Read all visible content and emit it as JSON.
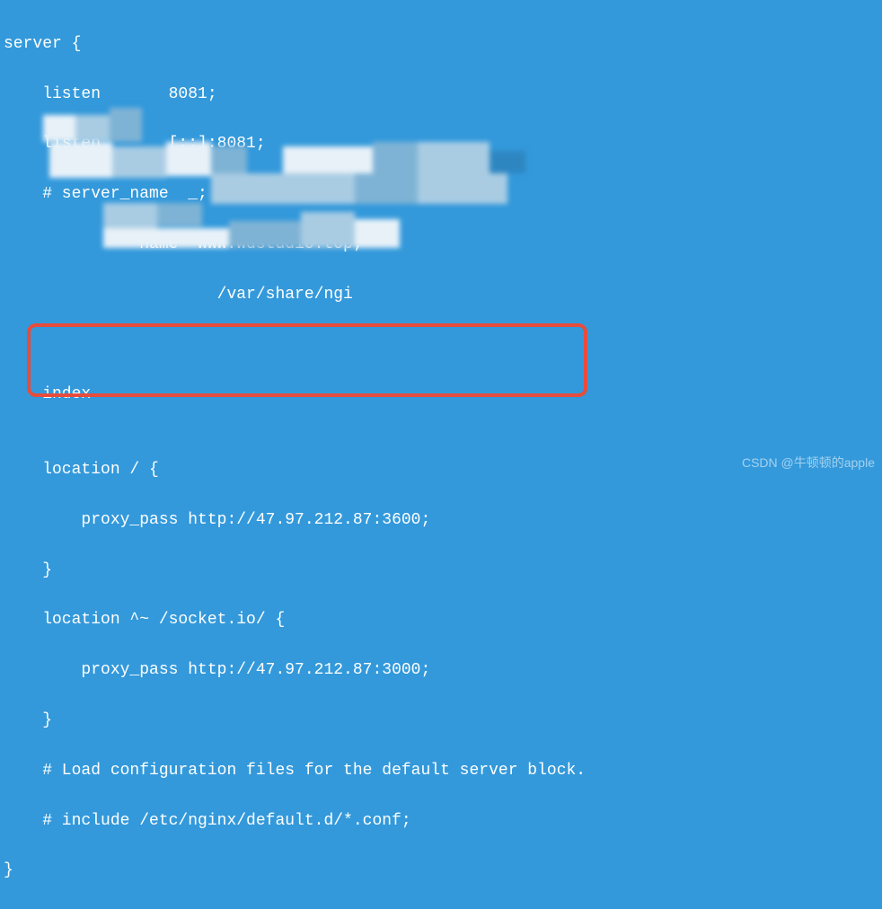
{
  "code": {
    "l0": "server {",
    "l1": "    listen       8081;",
    "l2": "    listen       [::]:8081;",
    "l3": "    # server_name  _;",
    "l4": "              name  www.wdstudio.top;",
    "l5": "                      /var/share/ngi",
    "l6": "",
    "l7": "",
    "l8": "    index",
    "l9": "",
    "l10": "    location / {",
    "l11": "        proxy_pass http://47.97.212.87:3600;",
    "l12": "    }",
    "l13": "    location ^~ /socket.io/ {",
    "l14": "        proxy_pass http://47.97.212.87:3000;",
    "l15": "    }",
    "l16": "    # Load configuration files for the default server block.",
    "l17": "    # include /etc/nginx/default.d/*.conf;",
    "l18": "}"
  },
  "watermark": "CSDN @牛顿顿的apple"
}
